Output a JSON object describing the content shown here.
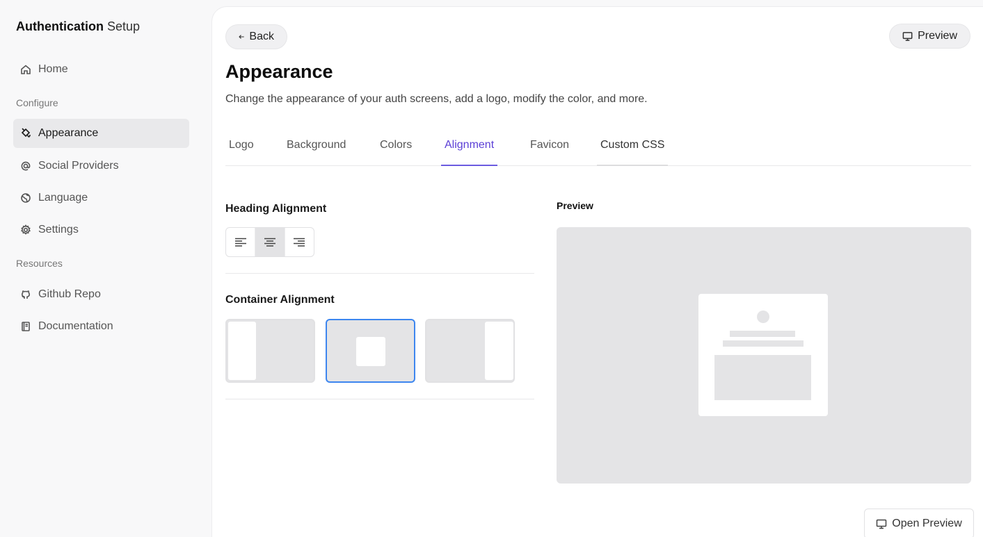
{
  "brand": {
    "bold": "Authentication",
    "light": "Setup"
  },
  "sidebar": {
    "items": [
      {
        "label": "Home",
        "icon": "home-icon"
      },
      {
        "label": "Appearance",
        "icon": "paint-bucket-icon",
        "active": true
      },
      {
        "label": "Social Providers",
        "icon": "at-sign-icon"
      },
      {
        "label": "Language",
        "icon": "globe-icon"
      },
      {
        "label": "Settings",
        "icon": "gear-icon"
      },
      {
        "label": "Github Repo",
        "icon": "github-icon"
      },
      {
        "label": "Documentation",
        "icon": "book-icon"
      }
    ],
    "sections": {
      "configure": "Configure",
      "resources": "Resources"
    }
  },
  "header": {
    "back_label": "Back",
    "preview_label": "Preview"
  },
  "page": {
    "title": "Appearance",
    "description": "Change the appearance of your auth screens, add a logo, modify the color, and more."
  },
  "tabs": [
    {
      "label": "Logo"
    },
    {
      "label": "Background"
    },
    {
      "label": "Colors"
    },
    {
      "label": "Alignment",
      "active": true
    },
    {
      "label": "Favicon"
    },
    {
      "label": "Custom CSS"
    }
  ],
  "alignment": {
    "heading_label": "Heading Alignment",
    "heading_selected": "center",
    "container_label": "Container Alignment",
    "container_selected": "center"
  },
  "preview": {
    "label": "Preview",
    "open_label": "Open Preview"
  },
  "colors": {
    "accent": "#5b3fd6",
    "selected_border": "#3d86ef",
    "placeholder": "#e4e4e6"
  }
}
